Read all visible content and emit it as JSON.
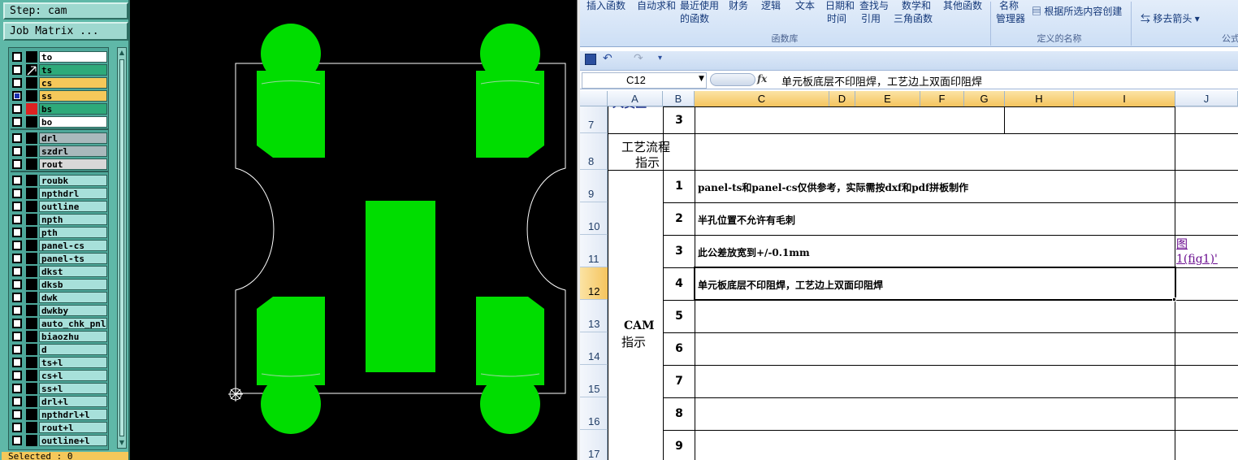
{
  "cam": {
    "step": "Step: cam",
    "job_matrix": "Job Matrix ...",
    "selected": "Selected : 0",
    "layers": [
      {
        "name": "to",
        "color": "#ffffff",
        "checked": false,
        "ind": "#000000"
      },
      {
        "name": "ts",
        "color": "#2eaa7a",
        "checked": false,
        "ind": "#000000"
      },
      {
        "name": "cs",
        "color": "#f5c85a",
        "checked": false,
        "ind": "#000000"
      },
      {
        "name": "ss",
        "color": "#f5c85a",
        "checked": true,
        "ind": "#000000"
      },
      {
        "name": "bs",
        "color": "#2eaa7a",
        "checked": false,
        "ind": "#dd2222"
      },
      {
        "name": "bo",
        "color": "#ffffff",
        "checked": false,
        "ind": "#000000"
      },
      {
        "name": "drl",
        "color": "#a9b9bc",
        "checked": false,
        "ind": "#000000"
      },
      {
        "name": "szdrl",
        "color": "#a9b9bc",
        "checked": false,
        "ind": "#000000"
      },
      {
        "name": "rout",
        "color": "#d8d8d8",
        "checked": false,
        "ind": "#000000"
      },
      {
        "name": "roubk",
        "color": "#a7e0da",
        "checked": false,
        "ind": "#000000"
      },
      {
        "name": "npthdrl",
        "color": "#a7e0da",
        "checked": false,
        "ind": "#000000"
      },
      {
        "name": "outline",
        "color": "#a7e0da",
        "checked": false,
        "ind": "#000000"
      },
      {
        "name": "npth",
        "color": "#a7e0da",
        "checked": false,
        "ind": "#000000"
      },
      {
        "name": "pth",
        "color": "#a7e0da",
        "checked": false,
        "ind": "#000000"
      },
      {
        "name": "panel-cs",
        "color": "#a7e0da",
        "checked": false,
        "ind": "#000000"
      },
      {
        "name": "panel-ts",
        "color": "#a7e0da",
        "checked": false,
        "ind": "#000000"
      },
      {
        "name": "dkst",
        "color": "#a7e0da",
        "checked": false,
        "ind": "#000000"
      },
      {
        "name": "dksb",
        "color": "#a7e0da",
        "checked": false,
        "ind": "#000000"
      },
      {
        "name": "dwk",
        "color": "#a7e0da",
        "checked": false,
        "ind": "#000000"
      },
      {
        "name": "dwkby",
        "color": "#a7e0da",
        "checked": false,
        "ind": "#000000"
      },
      {
        "name": "auto_chk_pnl",
        "color": "#a7e0da",
        "checked": false,
        "ind": "#000000"
      },
      {
        "name": "biaozhu",
        "color": "#a7e0da",
        "checked": false,
        "ind": "#000000"
      },
      {
        "name": "d",
        "color": "#a7e0da",
        "checked": false,
        "ind": "#000000"
      },
      {
        "name": "ts+l",
        "color": "#a7e0da",
        "checked": false,
        "ind": "#000000"
      },
      {
        "name": "cs+l",
        "color": "#a7e0da",
        "checked": false,
        "ind": "#000000"
      },
      {
        "name": "ss+l",
        "color": "#a7e0da",
        "checked": false,
        "ind": "#000000"
      },
      {
        "name": "drl+l",
        "color": "#a7e0da",
        "checked": false,
        "ind": "#000000"
      },
      {
        "name": "npthdrl+l",
        "color": "#a7e0da",
        "checked": false,
        "ind": "#000000"
      },
      {
        "name": "rout+l",
        "color": "#a7e0da",
        "checked": false,
        "ind": "#000000"
      },
      {
        "name": "outline+l",
        "color": "#a7e0da",
        "checked": false,
        "ind": "#000000"
      }
    ],
    "pad_color": "#00dd00",
    "outline_color": "#ffffff"
  },
  "excel": {
    "ribbon": {
      "items": [
        "插入函数",
        "自动求和",
        "最近使用",
        "的函数",
        "财务",
        "逻辑",
        "文本",
        "日期和",
        "时间",
        "查找与",
        "引用",
        "数学和",
        "三角函数",
        "其他函数",
        "名称",
        "管理器",
        "根据所选内容创建",
        "移去箭头",
        "公式"
      ],
      "group_function_library": "函数库",
      "group_defined_names": "定义的名称"
    },
    "name_box": "C12",
    "formula": "单元板底层不印阻焊，工艺边上双面印阻焊",
    "columns": [
      "A",
      "B",
      "C",
      "D",
      "E",
      "F",
      "G",
      "H",
      "I",
      "J"
    ],
    "rows": [
      "7",
      "8",
      "9",
      "10",
      "11",
      "12",
      "13",
      "14",
      "15",
      "16",
      "17"
    ],
    "cells": {
      "a8": "工艺流程",
      "a8b": "指示",
      "cam_label": "CAM",
      "cam_label2": "指示",
      "b7": "3",
      "nums": [
        "1",
        "2",
        "3",
        "4",
        "5",
        "6",
        "7",
        "8",
        "9"
      ],
      "instr1": "panel-ts和panel-cs仅供参考，实际需按dxf和pdf拼板制作",
      "instr2": "半孔位置不允许有毛刺",
      "instr3": "此公差放宽到+/-0.1mm",
      "instr4": "单元板底层不印阻焊，工艺边上双面印阻焊",
      "link1": "图",
      "link2": "1(fig1)'"
    }
  }
}
